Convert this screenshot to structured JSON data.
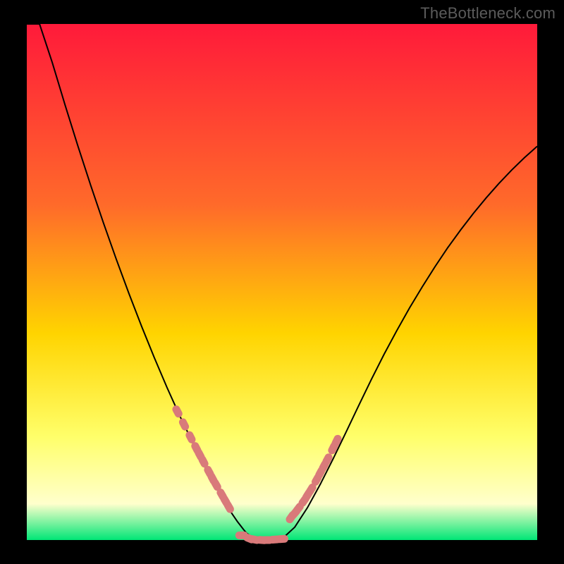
{
  "watermark": "TheBottleneck.com",
  "colors": {
    "background": "#000000",
    "gradient_top": "#ff1a3a",
    "gradient_mid_upper": "#ff6a2a",
    "gradient_mid": "#ffd400",
    "gradient_lower": "#ffff6a",
    "gradient_pale": "#ffffcc",
    "gradient_bottom": "#00e676",
    "curve_stroke": "#000000",
    "markers_fill": "#d97a7a"
  },
  "chart_data": {
    "type": "line",
    "title": "",
    "xlabel": "",
    "ylabel": "",
    "xlim": [
      0,
      100
    ],
    "ylim": [
      0,
      100
    ],
    "x": [
      0,
      2.5,
      5,
      7.5,
      10,
      12.5,
      15,
      17.5,
      20,
      22.5,
      25,
      27.5,
      30,
      32.5,
      35,
      37.5,
      38.75,
      40,
      41.25,
      42.5,
      43.1,
      45,
      47.5,
      50,
      52.5,
      55,
      57.5,
      60,
      62.5,
      65,
      67.5,
      70,
      72.5,
      75,
      77.5,
      80,
      82.5,
      85,
      87.5,
      90,
      92.5,
      95,
      97.5,
      100
    ],
    "series": [
      {
        "name": "bottleneck-curve",
        "values": [
          110,
          101,
          92.5,
          84.3,
          76.4,
          68.8,
          61.5,
          54.5,
          47.8,
          41.4,
          35.3,
          29.5,
          24.0,
          18.9,
          14.0,
          9.5,
          7.4,
          5.4,
          3.6,
          2.0,
          1.3,
          0.0,
          0.0,
          0.2,
          2.5,
          6.3,
          10.8,
          15.7,
          20.8,
          26.0,
          31.1,
          36.0,
          40.6,
          45.0,
          49.1,
          53.0,
          56.7,
          60.1,
          63.3,
          66.3,
          69.1,
          71.7,
          74.1,
          76.3
        ]
      }
    ],
    "markers_left": {
      "x": [
        29.5,
        30.8,
        32.1,
        33.2,
        33.9,
        34.6,
        35.7,
        36.4,
        37.1,
        38.2,
        38.9,
        39.6
      ],
      "y": [
        24.9,
        22.4,
        19.9,
        17.8,
        16.5,
        15.2,
        13.2,
        11.9,
        10.7,
        8.8,
        7.6,
        6.4
      ]
    },
    "markers_right": {
      "x": [
        51.8,
        52.5,
        53.2,
        54.3,
        55.0,
        55.7,
        56.8,
        57.5,
        58.2,
        58.9,
        60.0,
        60.7
      ],
      "y": [
        4.4,
        5.2,
        6.1,
        7.6,
        8.7,
        9.8,
        11.7,
        13.0,
        14.3,
        15.6,
        17.8,
        19.2
      ]
    },
    "markers_bottom": {
      "x": [
        42.1,
        43.6,
        44.6,
        46.1,
        47.1,
        48.6,
        50.0
      ],
      "y": [
        0.9,
        0.3,
        0.1,
        0.0,
        0.0,
        0.1,
        0.2
      ]
    }
  }
}
